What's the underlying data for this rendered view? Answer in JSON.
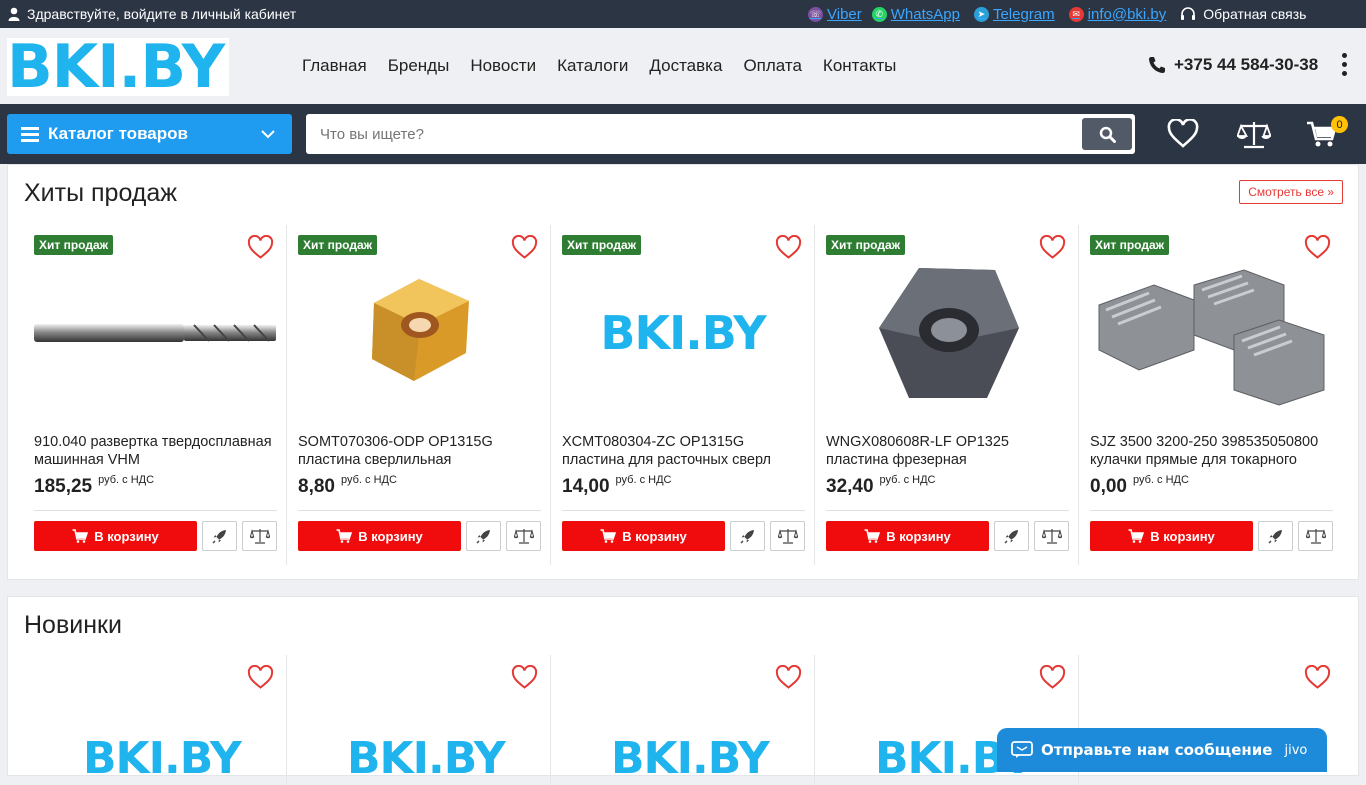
{
  "topbar": {
    "login_text": "Здравствуйте, войдите в личный кабинет",
    "viber": "Viber",
    "whatsapp": "WhatsApp",
    "telegram": "Telegram",
    "email": "info@bki.by",
    "callback": "Обратная связь"
  },
  "header": {
    "logo": "BKI.BY",
    "nav": [
      "Главная",
      "Бренды",
      "Новости",
      "Каталоги",
      "Доставка",
      "Оплата",
      "Контакты"
    ],
    "phone": "+375 44 584-30-38"
  },
  "mainbar": {
    "catalog_label": "Каталог товаров",
    "search_placeholder": "Что вы ищете?",
    "cart_count": "0"
  },
  "hits": {
    "title": "Хиты продаж",
    "see_all": "Смотреть все »",
    "badge": "Хит продаж",
    "cart_label": "В корзину",
    "vat_label": "руб. с НДС",
    "products": [
      {
        "name": "910.040 развертка твердосплавная машинная VHM",
        "price": "185,25",
        "image": "reamer"
      },
      {
        "name": "SOMT070306-ODP OP1315G пластина сверлильная",
        "price": "8,80",
        "image": "gold-insert"
      },
      {
        "name": "XCMT080304-ZC OP1315G пластина для расточных сверл",
        "price": "14,00",
        "image": "bki-logo"
      },
      {
        "name": "WNGX080608R-LF OP1325 пластина фрезерная",
        "price": "32,40",
        "image": "dark-insert"
      },
      {
        "name": "SJZ 3500 3200-250 398535050800 кулачки прямые для токарного",
        "price": "0,00",
        "image": "chuck-jaws"
      }
    ]
  },
  "new": {
    "title": "Новинки",
    "placeholder_logo": "BKI.BY"
  },
  "jivo": {
    "label": "Отправьте нам сообщение",
    "brand": "jivo"
  },
  "colors": {
    "brand_blue": "#1fb4ee",
    "dark_bar": "#2c3544",
    "catalog_btn": "#1f9bf0",
    "cart_btn": "#f00c0c",
    "hit_badge": "#2e7d32",
    "cart_badge": "#ffc107"
  }
}
